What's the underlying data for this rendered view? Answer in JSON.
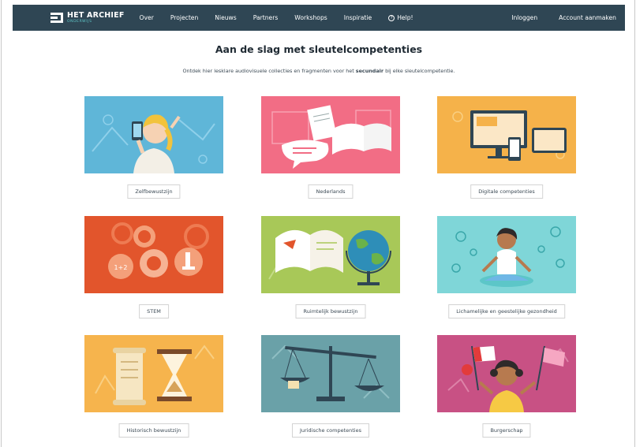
{
  "nav": {
    "logo_title": "HET ARCHIEF",
    "logo_sub": "ONDERWIJS",
    "items": [
      "Over",
      "Projecten",
      "Nieuws",
      "Partners",
      "Workshops",
      "Inspiratie",
      "Help!"
    ],
    "login": "Inloggen",
    "register": "Account aanmaken"
  },
  "page": {
    "title": "Aan de slag met sleutelcompetenties",
    "intro_before": "Ontdek hier lesklare audiovisuele collecties en fragmenten voor het ",
    "intro_bold": "secundair",
    "intro_after": " bij elke sleutelcompetentie."
  },
  "cards": [
    {
      "label": "Zelfbewustzijn",
      "bg": "#5fb6d8",
      "icon": "selfie-illustration"
    },
    {
      "label": "Nederlands",
      "bg": "#f26d85",
      "icon": "books-illustration"
    },
    {
      "label": "Digitale competenties",
      "bg": "#f5b24a",
      "icon": "devices-illustration"
    },
    {
      "label": "STEM",
      "bg": "#e2552c",
      "icon": "gears-illustration"
    },
    {
      "label": "Ruimtelijk bewustzijn",
      "bg": "#a8c858",
      "icon": "globe-illustration"
    },
    {
      "label": "Lichamelijke en geestelijke gezondheid",
      "bg": "#7fd6d8",
      "icon": "meditation-illustration"
    },
    {
      "label": "Historisch bewustzijn",
      "bg": "#f6b44d",
      "icon": "hourglass-illustration"
    },
    {
      "label": "Juridische competenties",
      "bg": "#6aa1a8",
      "icon": "scales-illustration"
    },
    {
      "label": "Burgerschap",
      "bg": "#c85184",
      "icon": "flags-illustration"
    }
  ]
}
